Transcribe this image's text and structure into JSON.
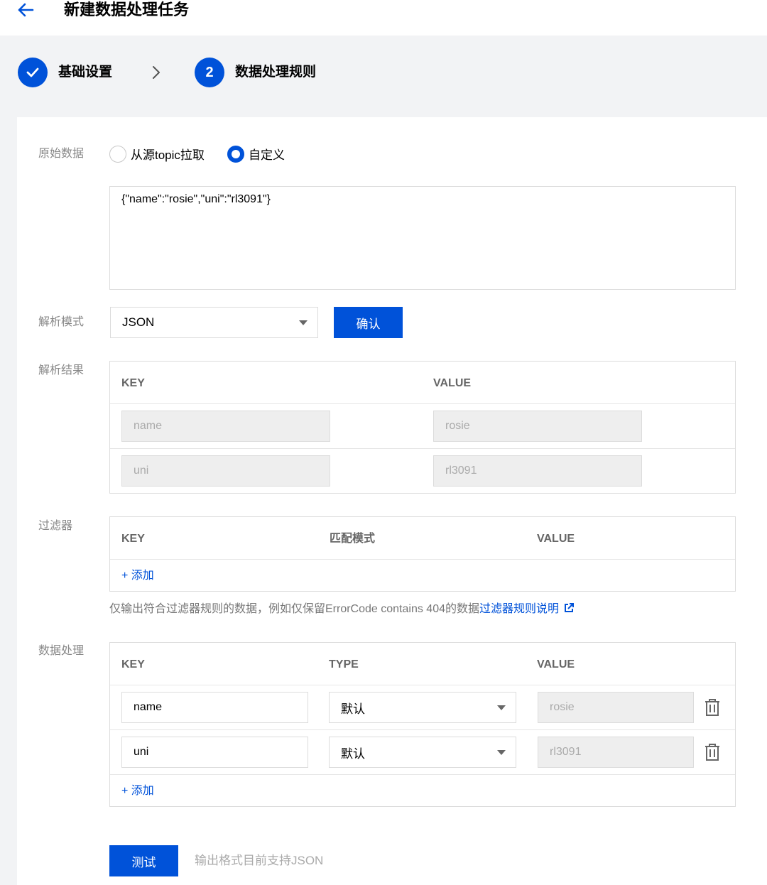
{
  "header": {
    "title": "新建数据处理任务"
  },
  "steps": [
    {
      "label": "基础设置",
      "status": "done"
    },
    {
      "number": "2",
      "label": "数据处理规则",
      "status": "active"
    }
  ],
  "raw_data": {
    "label": "原始数据",
    "options": [
      "从源topic拉取",
      "自定义"
    ],
    "selected": "自定义",
    "content": "{\"name\":\"rosie\",\"uni\":\"rl3091\"}"
  },
  "parse_mode": {
    "label": "解析模式",
    "value": "JSON",
    "confirm_label": "确认"
  },
  "parse_result": {
    "label": "解析结果",
    "columns": [
      "KEY",
      "VALUE"
    ],
    "rows": [
      {
        "key": "name",
        "value": "rosie"
      },
      {
        "key": "uni",
        "value": "rl3091"
      }
    ]
  },
  "filter": {
    "label": "过滤器",
    "columns": [
      "KEY",
      "匹配模式",
      "VALUE"
    ],
    "add_label": "+ 添加",
    "hint": "仅输出符合过滤器规则的数据，例如仅保留ErrorCode contains 404的数据",
    "hint_link": "过滤器规则说明"
  },
  "processing": {
    "label": "数据处理",
    "columns": [
      "KEY",
      "TYPE",
      "VALUE"
    ],
    "rows": [
      {
        "key": "name",
        "type": "默认",
        "value": "rosie"
      },
      {
        "key": "uni",
        "type": "默认",
        "value": "rl3091"
      }
    ],
    "add_label": "+ 添加"
  },
  "footer": {
    "test_label": "测试",
    "hint": "输出格式目前支持JSON"
  },
  "colors": {
    "primary": "#0052d9",
    "page_bg": "#f2f3f5",
    "border": "#dcdcdc"
  }
}
